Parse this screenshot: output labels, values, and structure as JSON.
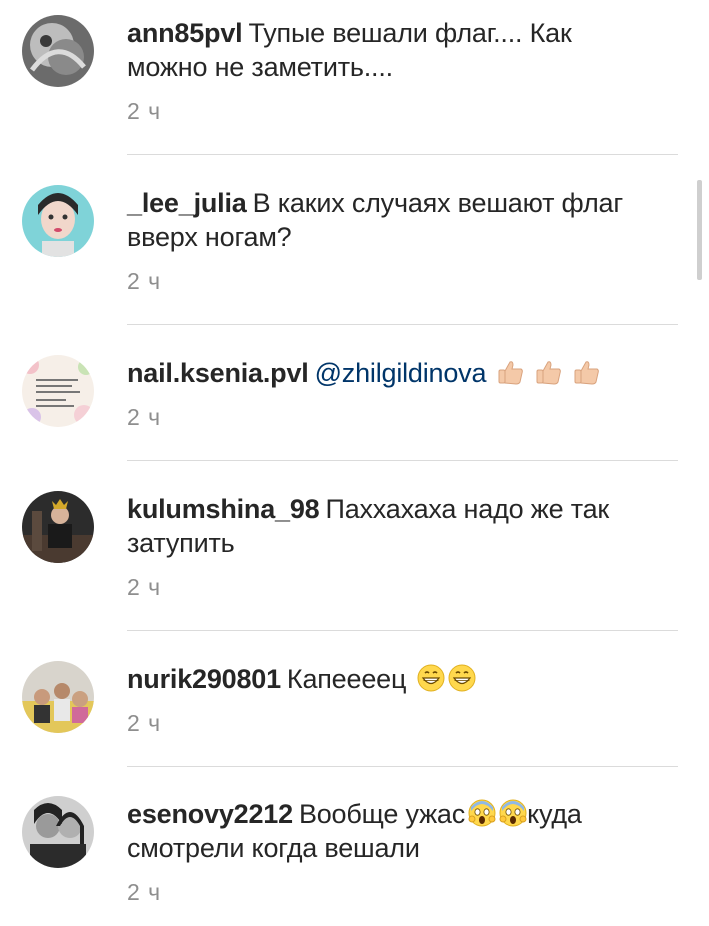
{
  "comments": [
    {
      "username": "ann85pvl",
      "text": "Тупые вешали флаг.... Как можно не заметить....",
      "time": "2 ч"
    },
    {
      "username": "_lee_julia",
      "text": "В каких случаях вешают флаг вверх ногам?",
      "time": "2 ч"
    },
    {
      "username": "nail.ksenia.pvl",
      "mention": "@zhilgildinova",
      "text": "",
      "time": "2 ч"
    },
    {
      "username": "kulumshina_98",
      "text": "Паххахаха надо же так затупить",
      "time": "2 ч"
    },
    {
      "username": "nurik290801",
      "text": "Капеееец",
      "time": "2 ч"
    },
    {
      "username": "esenovy2212",
      "text_before": "Вообще ужас",
      "text_after": "куда смотрели когда вешали",
      "time": "2 ч"
    }
  ],
  "icons": {
    "thumbs_up": "thumbs-up-icon",
    "grin": "grinning-face-icon",
    "scream": "screaming-face-icon"
  },
  "colors": {
    "username": "#262626",
    "mention": "#003569",
    "timestamp": "#8e8e8e",
    "divider": "#dbdbdb"
  }
}
